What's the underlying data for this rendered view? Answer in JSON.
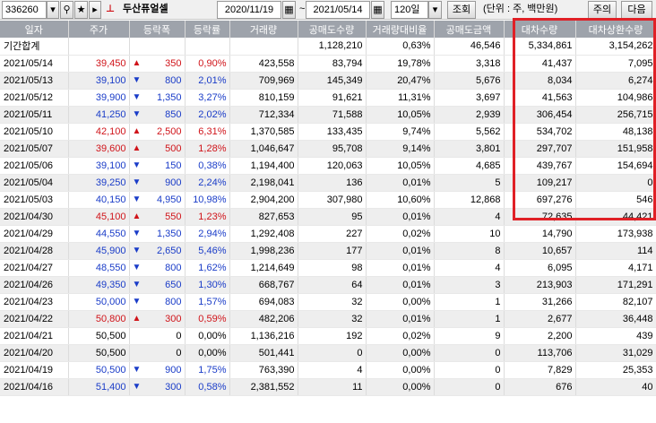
{
  "toolbar": {
    "code": "336260",
    "dropdown_icon": "chevron-down-icon",
    "search_icon": "search-icon",
    "star_icon": "star-icon",
    "menu_icon": "menu-icon",
    "chart_icon": "mini-chart-icon",
    "stock_name": "두산퓨얼셀",
    "start_date": "2020/11/19",
    "date_sep": "~",
    "end_date": "2021/05/14",
    "period": "120일",
    "query_button": "조회",
    "unit_text": "(단위 : 주, 백만원)",
    "notice_button": "주의",
    "next_button": "다음"
  },
  "table": {
    "headers": [
      "일자",
      "주가",
      "등락폭",
      "등락률",
      "거래량",
      "공매도수량",
      "거래량대비율",
      "공매도금액",
      "대차수량",
      "대차상환수량"
    ],
    "summary": {
      "label": "기간합계",
      "short_volume": "1,128,210",
      "volume_ratio": "0,63%",
      "short_amount": "46,546",
      "loan_qty": "5,334,861",
      "loan_repay": "3,154,262"
    },
    "rows": [
      {
        "date": "2021/05/14",
        "price": "39,450",
        "dir": "up",
        "arrow": "▲",
        "change": "350",
        "rate": "0,90%",
        "volume": "423,558",
        "short_volume": "83,794",
        "ratio": "19,78%",
        "short_amount": "3,318",
        "loan_qty": "41,437",
        "loan_repay": "7,095"
      },
      {
        "date": "2021/05/13",
        "price": "39,100",
        "dir": "down",
        "arrow": "▼",
        "change": "800",
        "rate": "2,01%",
        "volume": "709,969",
        "short_volume": "145,349",
        "ratio": "20,47%",
        "short_amount": "5,676",
        "loan_qty": "8,034",
        "loan_repay": "6,274"
      },
      {
        "date": "2021/05/12",
        "price": "39,900",
        "dir": "down",
        "arrow": "▼",
        "change": "1,350",
        "rate": "3,27%",
        "volume": "810,159",
        "short_volume": "91,621",
        "ratio": "11,31%",
        "short_amount": "3,697",
        "loan_qty": "41,563",
        "loan_repay": "104,986"
      },
      {
        "date": "2021/05/11",
        "price": "41,250",
        "dir": "down",
        "arrow": "▼",
        "change": "850",
        "rate": "2,02%",
        "volume": "712,334",
        "short_volume": "71,588",
        "ratio": "10,05%",
        "short_amount": "2,939",
        "loan_qty": "306,454",
        "loan_repay": "256,715"
      },
      {
        "date": "2021/05/10",
        "price": "42,100",
        "dir": "up",
        "arrow": "▲",
        "change": "2,500",
        "rate": "6,31%",
        "volume": "1,370,585",
        "short_volume": "133,435",
        "ratio": "9,74%",
        "short_amount": "5,562",
        "loan_qty": "534,702",
        "loan_repay": "48,138"
      },
      {
        "date": "2021/05/07",
        "price": "39,600",
        "dir": "up",
        "arrow": "▲",
        "change": "500",
        "rate": "1,28%",
        "volume": "1,046,647",
        "short_volume": "95,708",
        "ratio": "9,14%",
        "short_amount": "3,801",
        "loan_qty": "297,707",
        "loan_repay": "151,958"
      },
      {
        "date": "2021/05/06",
        "price": "39,100",
        "dir": "down",
        "arrow": "▼",
        "change": "150",
        "rate": "0,38%",
        "volume": "1,194,400",
        "short_volume": "120,063",
        "ratio": "10,05%",
        "short_amount": "4,685",
        "loan_qty": "439,767",
        "loan_repay": "154,694"
      },
      {
        "date": "2021/05/04",
        "price": "39,250",
        "dir": "down",
        "arrow": "▼",
        "change": "900",
        "rate": "2,24%",
        "volume": "2,198,041",
        "short_volume": "136",
        "ratio": "0,01%",
        "short_amount": "5",
        "loan_qty": "109,217",
        "loan_repay": "0"
      },
      {
        "date": "2021/05/03",
        "price": "40,150",
        "dir": "down",
        "arrow": "▼",
        "change": "4,950",
        "rate": "10,98%",
        "volume": "2,904,200",
        "short_volume": "307,980",
        "ratio": "10,60%",
        "short_amount": "12,868",
        "loan_qty": "697,276",
        "loan_repay": "546"
      },
      {
        "date": "2021/04/30",
        "price": "45,100",
        "dir": "up",
        "arrow": "▲",
        "change": "550",
        "rate": "1,23%",
        "volume": "827,653",
        "short_volume": "95",
        "ratio": "0,01%",
        "short_amount": "4",
        "loan_qty": "72,635",
        "loan_repay": "44,421"
      },
      {
        "date": "2021/04/29",
        "price": "44,550",
        "dir": "down",
        "arrow": "▼",
        "change": "1,350",
        "rate": "2,94%",
        "volume": "1,292,408",
        "short_volume": "227",
        "ratio": "0,02%",
        "short_amount": "10",
        "loan_qty": "14,790",
        "loan_repay": "173,938"
      },
      {
        "date": "2021/04/28",
        "price": "45,900",
        "dir": "down",
        "arrow": "▼",
        "change": "2,650",
        "rate": "5,46%",
        "volume": "1,998,236",
        "short_volume": "177",
        "ratio": "0,01%",
        "short_amount": "8",
        "loan_qty": "10,657",
        "loan_repay": "114"
      },
      {
        "date": "2021/04/27",
        "price": "48,550",
        "dir": "down",
        "arrow": "▼",
        "change": "800",
        "rate": "1,62%",
        "volume": "1,214,649",
        "short_volume": "98",
        "ratio": "0,01%",
        "short_amount": "4",
        "loan_qty": "6,095",
        "loan_repay": "4,171"
      },
      {
        "date": "2021/04/26",
        "price": "49,350",
        "dir": "down",
        "arrow": "▼",
        "change": "650",
        "rate": "1,30%",
        "volume": "668,767",
        "short_volume": "64",
        "ratio": "0,01%",
        "short_amount": "3",
        "loan_qty": "213,903",
        "loan_repay": "171,291"
      },
      {
        "date": "2021/04/23",
        "price": "50,000",
        "dir": "down",
        "arrow": "▼",
        "change": "800",
        "rate": "1,57%",
        "volume": "694,083",
        "short_volume": "32",
        "ratio": "0,00%",
        "short_amount": "1",
        "loan_qty": "31,266",
        "loan_repay": "82,107"
      },
      {
        "date": "2021/04/22",
        "price": "50,800",
        "dir": "up",
        "arrow": "▲",
        "change": "300",
        "rate": "0,59%",
        "volume": "482,206",
        "short_volume": "32",
        "ratio": "0,01%",
        "short_amount": "1",
        "loan_qty": "2,677",
        "loan_repay": "36,448"
      },
      {
        "date": "2021/04/21",
        "price": "50,500",
        "dir": "flat",
        "arrow": "",
        "change": "0",
        "rate": "0,00%",
        "volume": "1,136,216",
        "short_volume": "192",
        "ratio": "0,02%",
        "short_amount": "9",
        "loan_qty": "2,200",
        "loan_repay": "439"
      },
      {
        "date": "2021/04/20",
        "price": "50,500",
        "dir": "flat",
        "arrow": "",
        "change": "0",
        "rate": "0,00%",
        "volume": "501,441",
        "short_volume": "0",
        "ratio": "0,00%",
        "short_amount": "0",
        "loan_qty": "113,706",
        "loan_repay": "31,029"
      },
      {
        "date": "2021/04/19",
        "price": "50,500",
        "dir": "down",
        "arrow": "▼",
        "change": "900",
        "rate": "1,75%",
        "volume": "763,390",
        "short_volume": "4",
        "ratio": "0,00%",
        "short_amount": "0",
        "loan_qty": "7,829",
        "loan_repay": "25,353"
      },
      {
        "date": "2021/04/16",
        "price": "51,400",
        "dir": "down",
        "arrow": "▼",
        "change": "300",
        "rate": "0,58%",
        "volume": "2,381,552",
        "short_volume": "11",
        "ratio": "0,00%",
        "short_amount": "0",
        "loan_qty": "676",
        "loan_repay": "40"
      }
    ]
  },
  "colors": {
    "up": "#d0141a",
    "down": "#1a3cc8",
    "flat": "#000000",
    "highlight": "#e02026",
    "header": "#9ea3ab"
  }
}
